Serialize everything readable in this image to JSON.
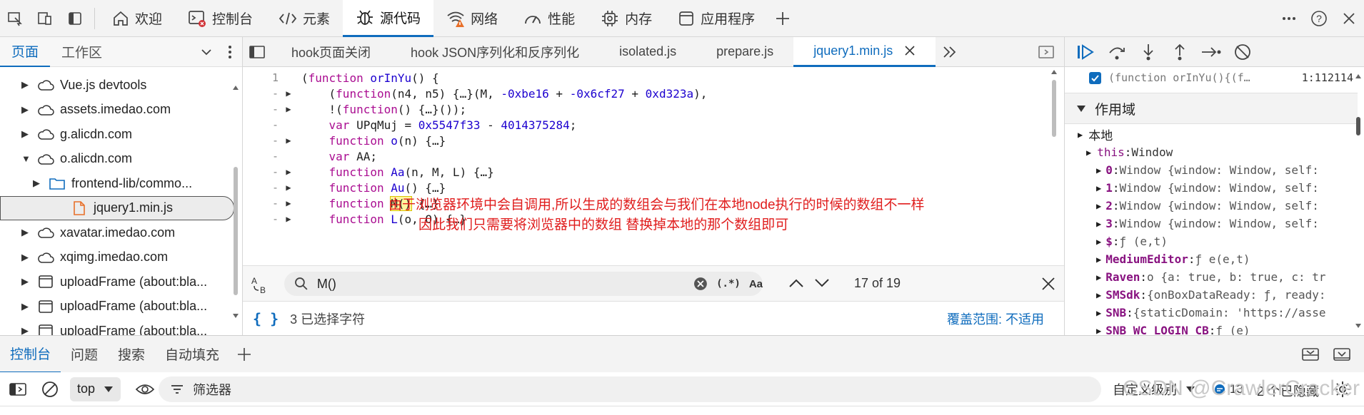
{
  "toolbar": {
    "tabs": [
      {
        "label": "欢迎",
        "icon": "home-icon"
      },
      {
        "label": "控制台",
        "icon": "console-icon"
      },
      {
        "label": "元素",
        "icon": "code-tag-icon"
      },
      {
        "label": "源代码",
        "icon": "bug-icon"
      },
      {
        "label": "网络",
        "icon": "wifi-warning-icon"
      },
      {
        "label": "性能",
        "icon": "gauge-icon"
      },
      {
        "label": "内存",
        "icon": "chip-icon"
      },
      {
        "label": "应用程序",
        "icon": "app-window-icon"
      }
    ],
    "active_tab": "源代码"
  },
  "left_panel": {
    "tabs": [
      "页面",
      "工作区"
    ],
    "tree": [
      {
        "label": "Vue.js devtools",
        "icon": "cloud-icon",
        "indent": 0
      },
      {
        "label": "assets.imedao.com",
        "icon": "cloud-icon",
        "indent": 0
      },
      {
        "label": "g.alicdn.com",
        "icon": "cloud-icon",
        "indent": 0
      },
      {
        "label": "o.alicdn.com",
        "icon": "cloud-icon",
        "indent": 0,
        "expanded": true
      },
      {
        "label": "frontend-lib/commo...",
        "icon": "folder-icon",
        "indent": 1
      },
      {
        "label": "jquery1.min.js",
        "icon": "file-icon",
        "indent": 2,
        "selected": true
      },
      {
        "label": "xavatar.imedao.com",
        "icon": "cloud-icon",
        "indent": 0
      },
      {
        "label": "xqimg.imedao.com",
        "icon": "cloud-icon",
        "indent": 0
      },
      {
        "label": "uploadFrame (about:bla...",
        "icon": "frame-icon",
        "indent": 0
      },
      {
        "label": "uploadFrame (about:bla...",
        "icon": "frame-icon",
        "indent": 0
      },
      {
        "label": "uploadFrame (about:bla...",
        "icon": "frame-icon",
        "indent": 0
      }
    ]
  },
  "editor": {
    "file_tabs": [
      "hook页面关闭",
      "hook JSON序列化和反序列化",
      "isolated.js",
      "prepare.js",
      "jquery1.min.js"
    ],
    "active_file": "jquery1.min.js",
    "lines": [
      {
        "num": "1",
        "fold": "",
        "segments": [
          {
            "t": "(",
            "c": "tx"
          },
          {
            "t": "function",
            "c": "kw"
          },
          {
            "t": " orInYu",
            "c": "fn"
          },
          {
            "t": "() {",
            "c": "tx"
          }
        ]
      },
      {
        "num": "-",
        "fold": "▶",
        "segments": [
          {
            "t": "    (",
            "c": "tx"
          },
          {
            "t": "function",
            "c": "kw"
          },
          {
            "t": "(n4, n5) {…}(M, ",
            "c": "tx"
          },
          {
            "t": "-0xbe16",
            "c": "nm"
          },
          {
            "t": " + ",
            "c": "tx"
          },
          {
            "t": "-0x6cf27",
            "c": "nm"
          },
          {
            "t": " + ",
            "c": "tx"
          },
          {
            "t": "0xd323a",
            "c": "nm"
          },
          {
            "t": "),",
            "c": "tx"
          }
        ]
      },
      {
        "num": "-",
        "fold": "▶",
        "segments": [
          {
            "t": "    !(",
            "c": "tx"
          },
          {
            "t": "function",
            "c": "kw"
          },
          {
            "t": "() {…}());",
            "c": "tx"
          }
        ]
      },
      {
        "num": "-",
        "fold": "",
        "segments": [
          {
            "t": "    ",
            "c": "tx"
          },
          {
            "t": "var",
            "c": "kw"
          },
          {
            "t": " UPqMuj = ",
            "c": "tx"
          },
          {
            "t": "0x5547f33",
            "c": "nm"
          },
          {
            "t": " - ",
            "c": "tx"
          },
          {
            "t": "4014375284",
            "c": "nm"
          },
          {
            "t": ";",
            "c": "tx"
          }
        ]
      },
      {
        "num": "-",
        "fold": "▶",
        "segments": [
          {
            "t": "    ",
            "c": "tx"
          },
          {
            "t": "function",
            "c": "kw"
          },
          {
            "t": " o",
            "c": "fn"
          },
          {
            "t": "(n) {…}",
            "c": "tx"
          }
        ]
      },
      {
        "num": "-",
        "fold": "",
        "segments": [
          {
            "t": "    ",
            "c": "tx"
          },
          {
            "t": "var",
            "c": "kw"
          },
          {
            "t": " AA;",
            "c": "tx"
          }
        ]
      },
      {
        "num": "-",
        "fold": "▶",
        "segments": [
          {
            "t": "    ",
            "c": "tx"
          },
          {
            "t": "function",
            "c": "kw"
          },
          {
            "t": " Aa",
            "c": "fn"
          },
          {
            "t": "(n, M, L) {…}",
            "c": "tx"
          }
        ]
      },
      {
        "num": "-",
        "fold": "▶",
        "segments": [
          {
            "t": "    ",
            "c": "tx"
          },
          {
            "t": "function",
            "c": "kw"
          },
          {
            "t": " Au",
            "c": "fn"
          },
          {
            "t": "() {…}",
            "c": "tx"
          }
        ]
      },
      {
        "num": "-",
        "fold": "▶",
        "segments": [
          {
            "t": "    ",
            "c": "tx"
          },
          {
            "t": "function",
            "c": "kw"
          },
          {
            "t": " ",
            "c": "tx"
          },
          {
            "t": "M()",
            "c": "hl"
          },
          {
            "t": " {…}",
            "c": "tx"
          }
        ]
      },
      {
        "num": "-",
        "fold": "▶",
        "segments": [
          {
            "t": "    ",
            "c": "tx"
          },
          {
            "t": "function",
            "c": "kw"
          },
          {
            "t": " L",
            "c": "fn"
          },
          {
            "t": "(o, O) {…}",
            "c": "tx"
          }
        ]
      }
    ],
    "annotation_line1": "由于浏览器环境中会自调用,所以生成的数组会与我们在本地node执行的时候的数组不一样",
    "annotation_line2": "因此我们只需要将浏览器中的数组 替换掉本地的那个数组即可"
  },
  "search": {
    "value": "M()",
    "regex_label": "(.*)",
    "case_label": "Aa",
    "match_count": "17 of 19"
  },
  "status": {
    "selected": "3 已选择字符",
    "coverage": "覆盖范围: 不适用"
  },
  "right_panel": {
    "breakpoint_label": "(function orInYu(){(f…",
    "breakpoint_location": "1:112114",
    "scope_title": "作用域",
    "local_label": "本地",
    "this_key": "this",
    "this_value": "Window",
    "props": [
      {
        "key": "0",
        "value": "Window {window: Window, self:"
      },
      {
        "key": "1",
        "value": "Window {window: Window, self:"
      },
      {
        "key": "2",
        "value": "Window {window: Window, self:"
      },
      {
        "key": "3",
        "value": "Window {window: Window, self:"
      },
      {
        "key": "$",
        "value": "ƒ (e,t)"
      },
      {
        "key": "MediumEditor",
        "value": "ƒ e(e,t)"
      },
      {
        "key": "Raven",
        "value": "o {a: true, b: true, c: tr"
      },
      {
        "key": "SMSdk",
        "value": "{onBoxDataReady: ƒ, ready:"
      },
      {
        "key": "SNB",
        "value": "{staticDomain: 'https://asse"
      },
      {
        "key": "SNB_WC_LOGIN_CB",
        "value": "ƒ (e)"
      }
    ]
  },
  "drawer": {
    "tabs": [
      "控制台",
      "问题",
      "搜索",
      "自动填充"
    ],
    "context": "top",
    "filter_placeholder": "筛选器",
    "level": "自定义级别",
    "message_count": "13",
    "hidden": "2 个已隐藏"
  },
  "watermark": "CSDN @CrawlerCracker",
  "colors": {
    "accent": "#0f6cbd",
    "annotation": "#e01d1d",
    "keyword": "#aa0d91",
    "number": "#1c00cf"
  }
}
